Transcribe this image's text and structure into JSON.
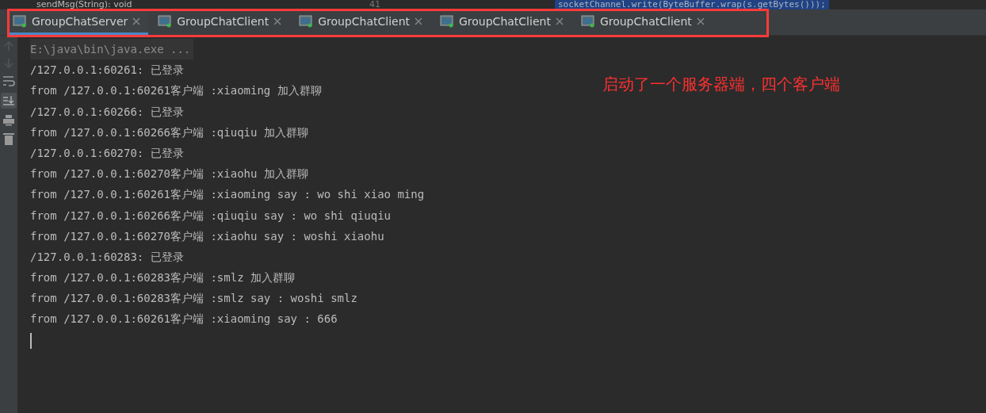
{
  "editor_peek": {
    "line_number": "41",
    "method": "sendMsg(String): void",
    "code": "socketChannel.write(ByteBuffer.wrap(s.getBytes()));"
  },
  "tabs": [
    {
      "label": "GroupChatServer",
      "selected": true
    },
    {
      "label": "GroupChatClient",
      "selected": false
    },
    {
      "label": "GroupChatClient",
      "selected": false
    },
    {
      "label": "GroupChatClient",
      "selected": false
    },
    {
      "label": "GroupChatClient",
      "selected": false
    }
  ],
  "console": {
    "command": "E:\\java\\bin\\java.exe ...",
    "lines": [
      "/127.0.0.1:60261: 已登录",
      "from /127.0.0.1:60261客户端 :xiaoming 加入群聊",
      "/127.0.0.1:60266: 已登录",
      "from /127.0.0.1:60266客户端 :qiuqiu 加入群聊",
      "/127.0.0.1:60270: 已登录",
      "from /127.0.0.1:60270客户端 :xiaohu 加入群聊",
      "from /127.0.0.1:60261客户端 :xiaoming say : wo shi xiao ming",
      "from /127.0.0.1:60266客户端 :qiuqiu say : wo shi qiuqiu",
      "from /127.0.0.1:60270客户端 :xiaohu say : woshi xiaohu",
      "/127.0.0.1:60283: 已登录",
      "from /127.0.0.1:60283客户端 :smlz 加入群聊",
      "from /127.0.0.1:60283客户端 :smlz say : woshi smlz",
      "from /127.0.0.1:60261客户端 :xiaoming say : 666"
    ]
  },
  "annotation": "启动了一个服务器端，四个客户端"
}
